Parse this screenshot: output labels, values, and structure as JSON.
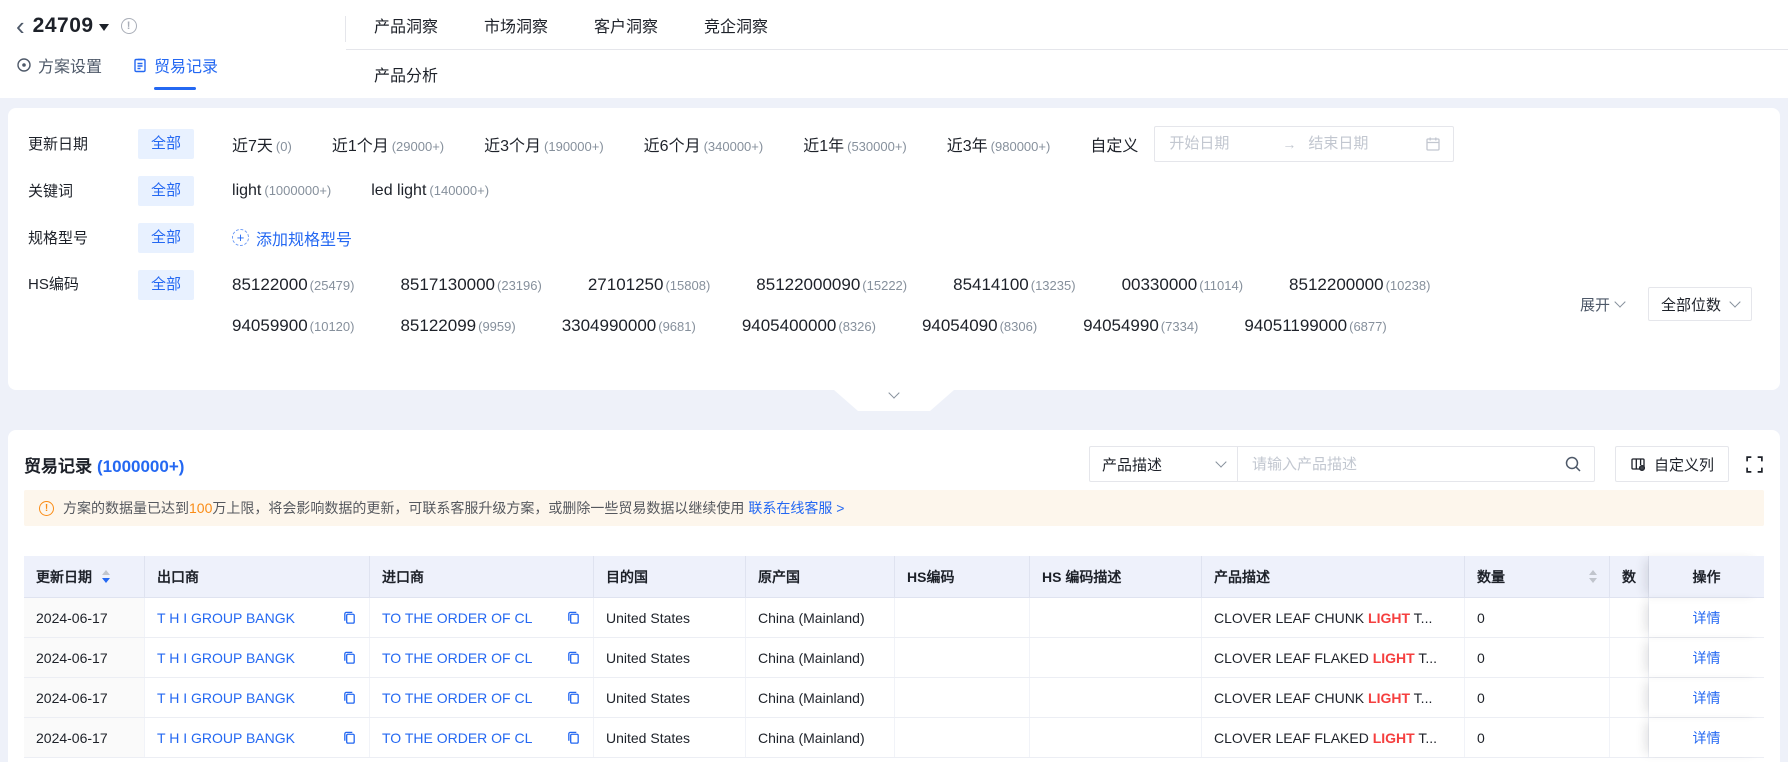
{
  "colors": {
    "primary": "#2468f2",
    "warning": "#fa8c16",
    "highlight_red": "#f53f3f",
    "chip_bg": "#e8f1ff",
    "banner_bg": "#fdf6ec"
  },
  "app": {
    "back_icon": "‹",
    "plan_id": "24709",
    "nav_tabs": [
      "产品洞察",
      "市场洞察",
      "客户洞察",
      "竞企洞察"
    ],
    "sub_nav": "产品分析",
    "plan_tabs": {
      "settings": "方案设置",
      "trade_records": "贸易记录"
    }
  },
  "filters": {
    "update_date": {
      "label": "更新日期",
      "all": "全部",
      "options": [
        {
          "text": "近7天",
          "count": "(0)"
        },
        {
          "text": "近1个月",
          "count": "(29000+)"
        },
        {
          "text": "近3个月",
          "count": "(190000+)"
        },
        {
          "text": "近6个月",
          "count": "(340000+)"
        },
        {
          "text": "近1年",
          "count": "(530000+)"
        },
        {
          "text": "近3年",
          "count": "(980000+)"
        }
      ],
      "custom": "自定义",
      "start_placeholder": "开始日期",
      "end_placeholder": "结束日期",
      "range_arrow": "→"
    },
    "keyword": {
      "label": "关键词",
      "all": "全部",
      "options": [
        {
          "text": "light",
          "count": "(1000000+)"
        },
        {
          "text": "led light",
          "count": "(140000+)"
        }
      ]
    },
    "spec": {
      "label": "规格型号",
      "all": "全部",
      "add_label": "添加规格型号"
    },
    "hs": {
      "label": "HS编码",
      "all": "全部",
      "codes_row1": [
        {
          "code": "85122000",
          "count": "(25479)"
        },
        {
          "code": "8517130000",
          "count": "(23196)"
        },
        {
          "code": "27101250",
          "count": "(15808)"
        },
        {
          "code": "85122000090",
          "count": "(15222)"
        },
        {
          "code": "85414100",
          "count": "(13235)"
        },
        {
          "code": "00330000",
          "count": "(11014)"
        },
        {
          "code": "8512200000",
          "count": "(10238)"
        }
      ],
      "codes_row2": [
        {
          "code": "94059900",
          "count": "(10120)"
        },
        {
          "code": "85122099",
          "count": "(9959)"
        },
        {
          "code": "3304990000",
          "count": "(9681)"
        },
        {
          "code": "9405400000",
          "count": "(8326)"
        },
        {
          "code": "94054090",
          "count": "(8306)"
        },
        {
          "code": "94054990",
          "count": "(7334)"
        },
        {
          "code": "94051199000",
          "count": "(6877)"
        }
      ],
      "expand": "展开",
      "digits": "全部位数"
    }
  },
  "records": {
    "title": "贸易记录",
    "count": "(1000000+)",
    "search_type": "产品描述",
    "search_placeholder": "请输入产品描述",
    "customize_columns": "自定义列",
    "banner": {
      "icon": "!",
      "prefix": "方案的数据量已达到",
      "highlight": "100",
      "suffix": "万上限，将会影响数据的更新，可联系客服升级方案，或删除一些贸易数据以继续使用",
      "link": "联系在线客服 >"
    },
    "table": {
      "headers": [
        "更新日期",
        "出口商",
        "进口商",
        "目的国",
        "原产国",
        "HS编码",
        "HS 编码描述",
        "产品描述",
        "数量",
        "数",
        "操作"
      ],
      "rows": [
        {
          "date": "2024-06-17",
          "exporter": "T H I GROUP BANGK",
          "importer": "TO THE ORDER OF CL",
          "destination": "United States",
          "origin": "China (Mainland)",
          "hs_code": "",
          "hs_desc": "",
          "product_pre": "CLOVER LEAF CHUNK ",
          "product_hl": "LIGHT",
          "product_post": " T...",
          "quantity": "0",
          "action": "详情"
        },
        {
          "date": "2024-06-17",
          "exporter": "T H I GROUP BANGK",
          "importer": "TO THE ORDER OF CL",
          "destination": "United States",
          "origin": "China (Mainland)",
          "hs_code": "",
          "hs_desc": "",
          "product_pre": "CLOVER LEAF FLAKED ",
          "product_hl": "LIGHT",
          "product_post": " T...",
          "quantity": "0",
          "action": "详情"
        },
        {
          "date": "2024-06-17",
          "exporter": "T H I GROUP BANGK",
          "importer": "TO THE ORDER OF CL",
          "destination": "United States",
          "origin": "China (Mainland)",
          "hs_code": "",
          "hs_desc": "",
          "product_pre": "CLOVER LEAF CHUNK ",
          "product_hl": "LIGHT",
          "product_post": " T...",
          "quantity": "0",
          "action": "详情"
        },
        {
          "date": "2024-06-17",
          "exporter": "T H I GROUP BANGK",
          "importer": "TO THE ORDER OF CL",
          "destination": "United States",
          "origin": "China (Mainland)",
          "hs_code": "",
          "hs_desc": "",
          "product_pre": "CLOVER LEAF FLAKED ",
          "product_hl": "LIGHT",
          "product_post": " T...",
          "quantity": "0",
          "action": "详情"
        }
      ]
    }
  }
}
